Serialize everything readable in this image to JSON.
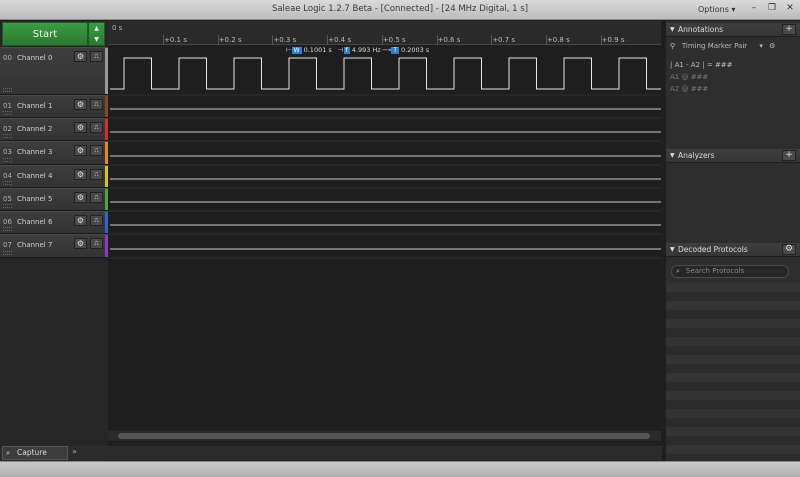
{
  "window": {
    "title": "Saleae Logic 1.2.7 Beta - [Connected] - [24 MHz Digital, 1 s]",
    "options_label": "Options",
    "minimize_icon": "minimize-icon",
    "restore_icon": "restore-icon",
    "close_icon": "close-icon"
  },
  "capture": {
    "start_label": "Start",
    "capture_tab_label": "Capture"
  },
  "channels": [
    {
      "num": "00",
      "name": "Channel 0",
      "color": "#9a9a9a"
    },
    {
      "num": "01",
      "name": "Channel 1",
      "color": "#7a4a2a"
    },
    {
      "num": "02",
      "name": "Channel 2",
      "color": "#d0302a"
    },
    {
      "num": "03",
      "name": "Channel 3",
      "color": "#e08a1e"
    },
    {
      "num": "04",
      "name": "Channel 4",
      "color": "#d8c21e"
    },
    {
      "num": "05",
      "name": "Channel 5",
      "color": "#48a838"
    },
    {
      "num": "06",
      "name": "Channel 6",
      "color": "#3a5fd0"
    },
    {
      "num": "07",
      "name": "Channel 7",
      "color": "#8a3ac8"
    }
  ],
  "ruler": {
    "zero": "0 s",
    "ticks": [
      "+0.1 s",
      "+0.2 s",
      "+0.3 s",
      "+0.4 s",
      "+0.5 s",
      "+0.6 s",
      "+0.7 s",
      "+0.8 s",
      "+0.9 s"
    ]
  },
  "measurements": {
    "width_badge": "W",
    "width": "0.1001 s",
    "freq_badge": "f",
    "freq": "4.993 Hz",
    "period_badge": "T",
    "period": "0.2003 s"
  },
  "annotations": {
    "header": "Annotations",
    "marker_pair": "Timing Marker Pair",
    "a1_a2_formula": "| A1 - A2 | = ###",
    "a1": "A1  @  ###",
    "a2": "A2  @  ###"
  },
  "analyzers": {
    "header": "Analyzers"
  },
  "decoded": {
    "header": "Decoded Protocols",
    "search_placeholder": "Search Protocols"
  }
}
